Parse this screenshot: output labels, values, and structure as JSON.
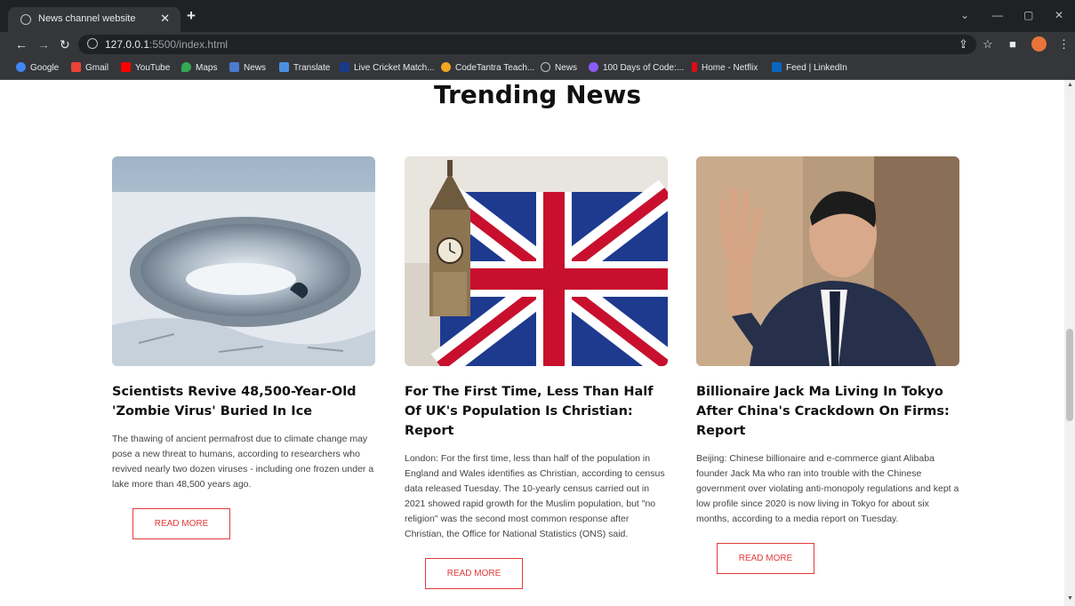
{
  "browser": {
    "tab_title": "News channel website",
    "url_host": "127.0.0.1",
    "url_rest": ":5500/index.html"
  },
  "bookmarks": [
    {
      "label": "Google",
      "color": "#4285f4"
    },
    {
      "label": "Gmail",
      "color": "#ea4335"
    },
    {
      "label": "YouTube",
      "color": "#ff0000"
    },
    {
      "label": "Maps",
      "color": "#34a853"
    },
    {
      "label": "News",
      "color": "#4a7bd0"
    },
    {
      "label": "Translate",
      "color": "#4a90e2"
    },
    {
      "label": "Live Cricket Match...",
      "color": "#1a3a8a"
    },
    {
      "label": "CodeTantra Teach...",
      "color": "#f5a623"
    },
    {
      "label": "News",
      "color": "#9aa0a6"
    },
    {
      "label": "100 Days of Code:...",
      "color": "#8b5cf6"
    },
    {
      "label": "Home - Netflix",
      "color": "#e50914"
    },
    {
      "label": "Feed | LinkedIn",
      "color": "#0a66c2"
    }
  ],
  "page": {
    "heading": "Trending News",
    "accent_color": "#e23b3b",
    "cards": [
      {
        "image": "permafrost-crater-image",
        "title": "Scientists Revive 48,500-Year-Old 'Zombie Virus' Buried In Ice",
        "body": "The thawing of ancient permafrost due to climate change may pose a new threat to humans, according to researchers who revived nearly two dozen viruses - including one frozen under a lake more than 48,500 years ago.",
        "button": "READ MORE"
      },
      {
        "image": "big-ben-union-flag-image",
        "title": "For The First Time, Less Than Half Of UK's Population Is Christian: Report",
        "body": "London: For the first time, less than half of the population in England and Wales identifies as Christian, according to census data released Tuesday. The 10-yearly census carried out in 2021 showed rapid growth for the Muslim population, but \"no religion\" was the second most common response after Christian, the Office for National Statistics (ONS) said.",
        "button": "READ MORE"
      },
      {
        "image": "jack-ma-waving-image",
        "title": "Billionaire Jack Ma Living In Tokyo After China's Crackdown On Firms: Report",
        "body": "Beijing: Chinese billionaire and e-commerce giant Alibaba founder Jack Ma who ran into trouble with the Chinese government over violating anti-monopoly regulations and kept a low profile since 2020 is now living in Tokyo for about six months, according to a media report on Tuesday.",
        "button": "READ MORE"
      }
    ]
  }
}
